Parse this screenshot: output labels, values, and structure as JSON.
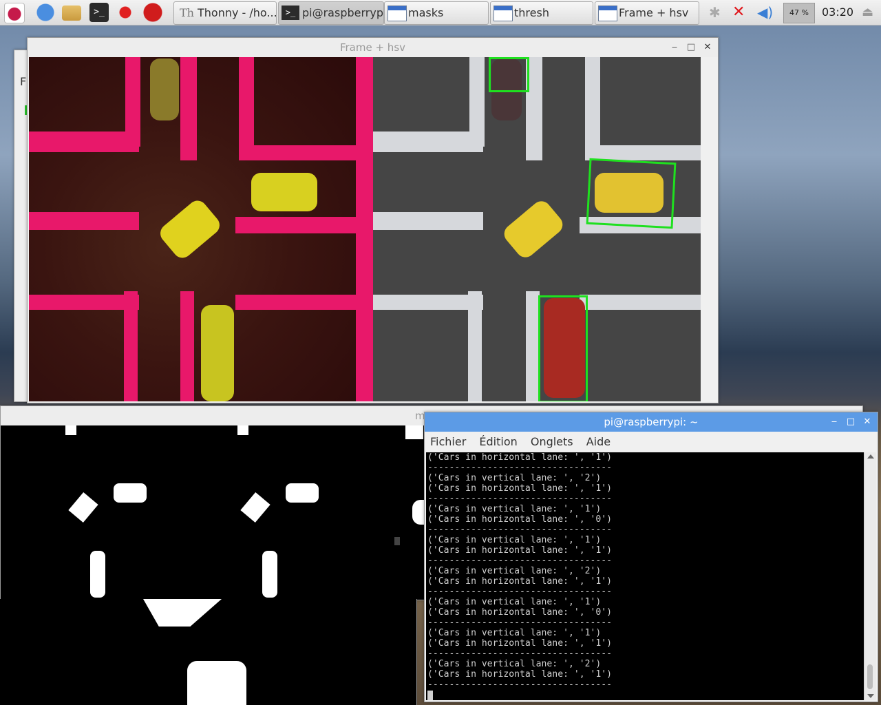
{
  "taskbar": {
    "tasks": [
      {
        "label": "Thonny  -  /ho..."
      },
      {
        "label": "pi@raspberryp..."
      },
      {
        "label": "masks"
      },
      {
        "label": "thresh"
      },
      {
        "label": "Frame + hsv"
      }
    ],
    "cpu": "47 %",
    "clock": "03:20"
  },
  "frame_window": {
    "title": "Frame + hsv",
    "minimize": "‒",
    "maximize": "□",
    "close": "✕"
  },
  "thonny_window": {
    "partial_label": "F"
  },
  "masks_window": {
    "partial_title": "m"
  },
  "terminal": {
    "title": "pi@raspberrypi: ~",
    "menu": [
      "Fichier",
      "Édition",
      "Onglets",
      "Aide"
    ],
    "lines": [
      "('Cars in horizontal lane: ', '1')",
      "----------------------------------",
      "('Cars in vertical lane: ', '2')",
      "('Cars in horizontal lane: ', '1')",
      "----------------------------------",
      "('Cars in vertical lane: ', '1')",
      "('Cars in horizontal lane: ', '0')",
      "----------------------------------",
      "('Cars in vertical lane: ', '1')",
      "('Cars in horizontal lane: ', '1')",
      "----------------------------------",
      "('Cars in vertical lane: ', '2')",
      "('Cars in horizontal lane: ', '1')",
      "----------------------------------",
      "('Cars in vertical lane: ', '1')",
      "('Cars in horizontal lane: ', '0')",
      "----------------------------------",
      "('Cars in vertical lane: ', '1')",
      "('Cars in horizontal lane: ', '1')",
      "----------------------------------",
      "('Cars in vertical lane: ', '2')",
      "('Cars in horizontal lane: ', '1')",
      "----------------------------------"
    ]
  },
  "colors": {
    "terminal_title": "#5c9be6",
    "bbox": "#1fe01f",
    "hsv_stripe": "#e8186a"
  }
}
